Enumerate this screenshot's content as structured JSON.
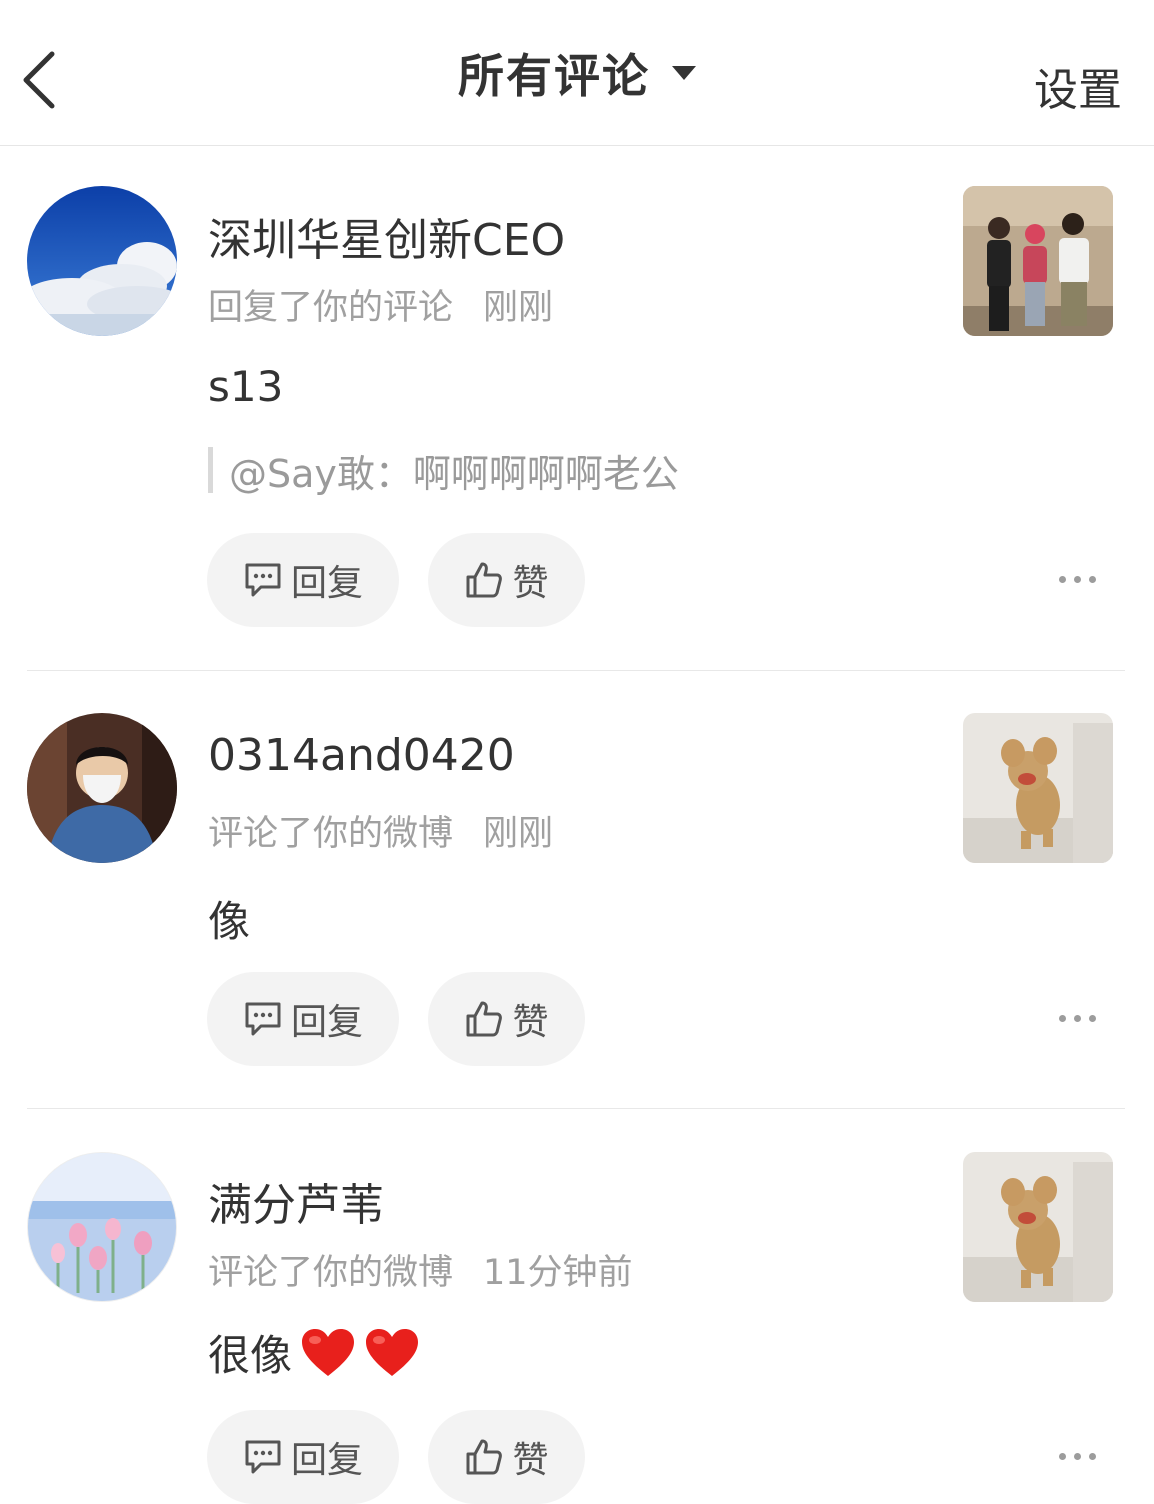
{
  "header": {
    "title": "所有评论",
    "settings": "设置"
  },
  "comments": [
    {
      "name": "深圳华星创新CEO",
      "action": "回复了你的评论",
      "time": "刚刚",
      "content": "s13",
      "quote": "@Say敢：啊啊啊啊啊老公",
      "reply_label": "回复",
      "like_label": "赞"
    },
    {
      "name": "0314and0420",
      "action": "评论了你的微博",
      "time": "刚刚",
      "content": "像",
      "reply_label": "回复",
      "like_label": "赞"
    },
    {
      "name": "满分芦苇",
      "action": "评论了你的微博",
      "time": "11分钟前",
      "content": "很像",
      "reply_label": "回复",
      "like_label": "赞"
    }
  ],
  "colors": {
    "text": "#333333",
    "meta": "#a0a0a0",
    "button_bg": "#f3f3f3",
    "heart": "#e8201c"
  }
}
